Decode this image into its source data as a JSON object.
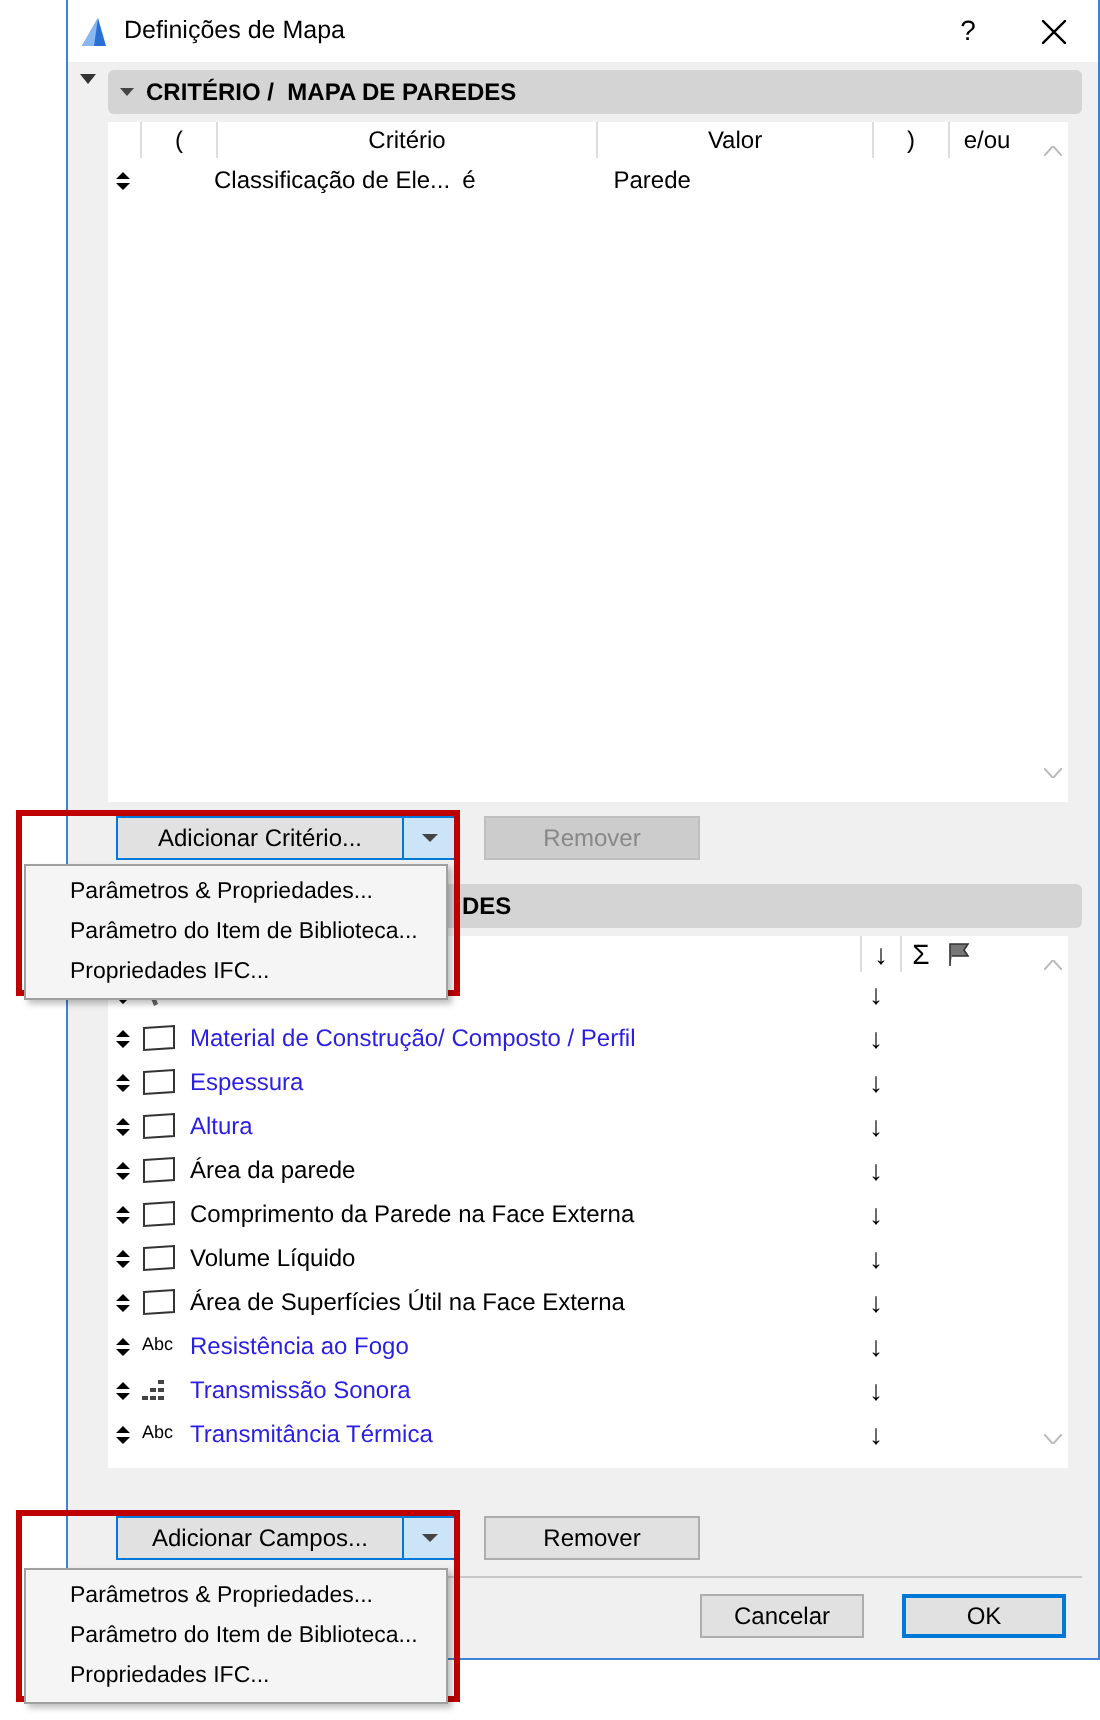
{
  "window": {
    "title": "Definições de Mapa",
    "help": "?"
  },
  "criteria_section": {
    "title": "CRITÉRIO /  MAPA DE PAREDES",
    "expanded": true,
    "columns": [
      "(",
      "Critério",
      "Valor",
      ")",
      "e/ou"
    ],
    "rows": [
      {
        "criterion": "Classificação de Ele...",
        "operator": "é",
        "value": "Parede"
      }
    ]
  },
  "criteria_buttons": {
    "add": "Adicionar Critério...",
    "add_focused": true,
    "remove": "Remover",
    "remove_disabled": true
  },
  "criteria_menu": {
    "items": [
      "Parâmetros & Propriedades...",
      "Parâmetro do Item de Biblioteca...",
      "Propriedades IFC..."
    ]
  },
  "fields_section": {
    "title": "DES",
    "expanded": true,
    "columns": [
      "↓",
      "Σ"
    ],
    "rows": [
      {
        "kind": "pin",
        "sort": "↓"
      },
      {
        "kind": "wall",
        "label": "Material de Construção/ Composto / Perfil",
        "linked": true,
        "sort": "↓"
      },
      {
        "kind": "wall",
        "label": "Espessura",
        "linked": true,
        "sort": "↓"
      },
      {
        "kind": "wall",
        "label": "Altura",
        "linked": true,
        "sort": "↓"
      },
      {
        "kind": "wall",
        "label": "Área da parede",
        "linked": false,
        "sort": "↓"
      },
      {
        "kind": "wall",
        "label": "Comprimento da Parede na Face Externa",
        "linked": false,
        "sort": "↓"
      },
      {
        "kind": "wall",
        "label": "Volume Líquido",
        "linked": false,
        "sort": "↓"
      },
      {
        "kind": "wall",
        "label": "Área de Superfícies Útil na Face Externa",
        "linked": false,
        "sort": "↓"
      },
      {
        "kind": "text",
        "icon_text": "Abc",
        "label": "Resistência ao Fogo",
        "linked": true,
        "sort": "↓"
      },
      {
        "kind": "grid",
        "label": "Transmissão Sonora",
        "linked": true,
        "sort": "↓"
      },
      {
        "kind": "text",
        "icon_text": "Abc",
        "label": "Transmitância Térmica",
        "linked": true,
        "sort": "↓"
      }
    ]
  },
  "fields_buttons": {
    "add": "Adicionar Campos...",
    "add_focused": true,
    "remove": "Remover",
    "remove_disabled": false
  },
  "fields_menu": {
    "items": [
      "Parâmetros & Propriedades...",
      "Parâmetro do Item de Biblioteca...",
      "Propriedades IFC..."
    ]
  },
  "footer": {
    "cancel": "Cancelar",
    "ok": "OK",
    "ok_default": true
  }
}
